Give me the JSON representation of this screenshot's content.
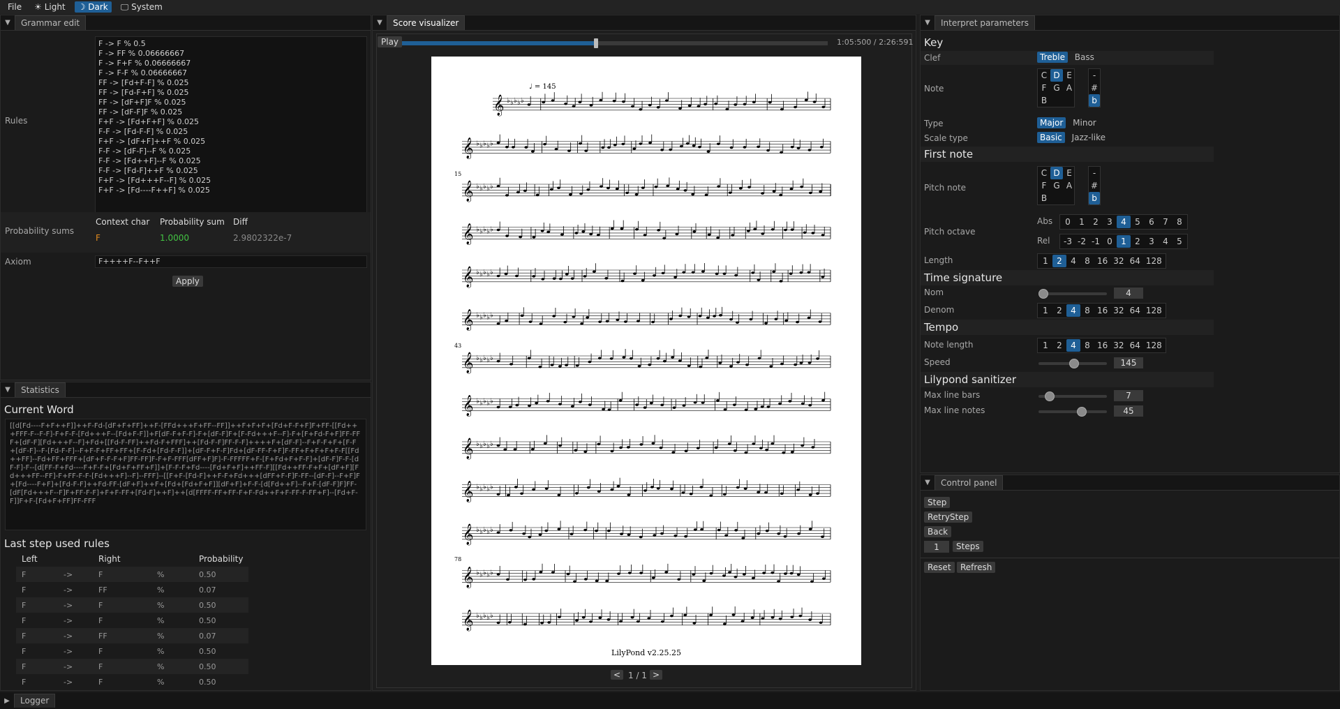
{
  "menubar": {
    "file": "File",
    "light": "Light",
    "dark": "Dark",
    "system": "System"
  },
  "grammar": {
    "tab": "Grammar edit",
    "rules_label": "Rules",
    "rules": [
      "F -> F % 0.5",
      "F -> FF % 0.06666667",
      "F -> F+F % 0.06666667",
      "F -> F-F % 0.06666667",
      "FF -> [Fd+F-F] % 0.025",
      "FF -> [Fd-F+F] % 0.025",
      "FF -> [dF+F]F % 0.025",
      "FF -> [dF-F]F % 0.025",
      "F+F -> [Fd+F+F] % 0.025",
      "F-F -> [Fd-F-F] % 0.025",
      "F+F -> [dF+F]++F % 0.025",
      "F-F -> [dF-F]--F % 0.025",
      "F-F -> [Fd++F]--F % 0.025",
      "F-F -> [Fd-F]++F % 0.025",
      "F+F -> [Fd+++F--F] % 0.025",
      "F+F -> [Fd----F++F] % 0.025"
    ],
    "prob_label": "Probability sums",
    "prob_headers": [
      "Context char",
      "Probability sum",
      "Diff"
    ],
    "prob_row": [
      "F",
      "1.0000",
      "2.9802322e-7"
    ],
    "axiom_label": "Axiom",
    "axiom": "F++++F--F++F",
    "apply": "Apply"
  },
  "statistics": {
    "tab": "Statistics",
    "current_word_title": "Current Word",
    "current_word": "[[d[Fd----F+F++F]]++F-Fd-[dF+F+FF]++F-[FFd+++F+FF--FF]]++F+F+F+[Fd+F-F+F]F+FF-[[Fd+++FFF-F--F-F]-F+F-F-[Fd+++F--[Fd+F-F]]+F[dF-F+F-F]-F+[dF-F]F+[F-Fd+++F--F]-F+[F+Fd-F+F]FF-FFF+[dF-F][Fd+++F--F]+Fd+[[Fd-F-FF]++Fd-F+FFF]++[Fd-F-F]FF-F-F]++++F+[dF-F]--F+F-F+F+[F-F+[dF-F]--F-[Fd-F-F]--F+F-F+FF+FF+[F-Fd+[Fd-F-F]]+[dF-F+F-F]Fd+[dF-FF-F+F]F-FF+F+F+F+F-F[[Fd++FF]--Fd+FF+FFF+[dF+F-F-F+F]FF-FF]F-F+F-FFF[dFF+F]F]-F-FFFFF+F-[F+Fd+F+F-F]+[dF-F]F-F-[dF-F]-F--[d[FF-F+Fd----F+F-F+[Fd+F+FF+F]]+[F-F-F+Fd----[Fd+F+F]++FF-F][[Fd++FF-F+F+[dF+F][Fd+++FF--FF]-F+FF-F-F-[Fd+++F]--F]--FFF]--[[F+F-[Fd-F]++F-F+Fd+++[dFF+F-F]F-FF--[dF-F]--F+F]F+[Fd----F+F]+[Fd-F-F]++Fd-FF-[dF+F]++F+[Fd+[Fd+F+F]][dF+F]+F-F-[d[Fd++F]--F+F-[dF-F]F]FF-[dF[Fd+++F--F]F+FF-F-F]+F+F-FF+[Fd-F]++F]++[d[FFFF-FF+FF-F+F-Fd++F+F-FF-F-FF+F]--[Fd+F-F]]F+F-[Fd+F+FF]FF-FFF",
    "last_rules_title": "Last step used rules",
    "headers": [
      "Left",
      "Right",
      "Probability"
    ],
    "rows": [
      [
        "F",
        "->",
        "F",
        "%",
        "0.50"
      ],
      [
        "F",
        "->",
        "FF",
        "%",
        "0.07"
      ],
      [
        "F",
        "->",
        "F",
        "%",
        "0.50"
      ],
      [
        "F",
        "->",
        "F",
        "%",
        "0.50"
      ],
      [
        "F",
        "->",
        "FF",
        "%",
        "0.07"
      ],
      [
        "F",
        "->",
        "F",
        "%",
        "0.50"
      ],
      [
        "F",
        "->",
        "F",
        "%",
        "0.50"
      ],
      [
        "F",
        "->",
        "F",
        "%",
        "0.50"
      ]
    ]
  },
  "score": {
    "tab": "Score visualizer",
    "play": "Play",
    "progress": 0.456,
    "time": "1:05:500 / 2:26:591",
    "tempo_mark": "= 145",
    "measure_numbers": [
      "15",
      "43",
      "78"
    ],
    "footer": "LilyPond v2.25.25",
    "page": "1 / 1",
    "prev": "<",
    "next": ">"
  },
  "params": {
    "tab": "Interpret parameters",
    "key_title": "Key",
    "clef_label": "Clef",
    "clef_options": [
      "Treble",
      "Bass"
    ],
    "note_label": "Note",
    "notes": [
      "C",
      "D",
      "E",
      "F",
      "G",
      "A",
      "B"
    ],
    "accidentals": [
      "-",
      "#",
      "b"
    ],
    "type_label": "Type",
    "type_options": [
      "Major",
      "Minor"
    ],
    "scale_label": "Scale type",
    "scale_options": [
      "Basic",
      "Jazz-like"
    ],
    "first_note_title": "First note",
    "pitch_note_label": "Pitch note",
    "pitch_octave_label": "Pitch octave",
    "abs_label": "Abs",
    "abs_values": [
      "0",
      "1",
      "2",
      "3",
      "4",
      "5",
      "6",
      "7",
      "8"
    ],
    "rel_label": "Rel",
    "rel_values": [
      "-3",
      "-2",
      "-1",
      "0",
      "1",
      "2",
      "3",
      "4",
      "5"
    ],
    "length_label": "Length",
    "lengths": [
      "1",
      "2",
      "4",
      "8",
      "16",
      "32",
      "64",
      "128"
    ],
    "time_sig_title": "Time signature",
    "nom_label": "Nom",
    "nom_value": "4",
    "denom_label": "Denom",
    "tempo_title": "Tempo",
    "note_length_label": "Note length",
    "speed_label": "Speed",
    "speed_value": "145",
    "sanitizer_title": "Lilypond sanitizer",
    "max_bars_label": "Max line bars",
    "max_bars_value": "7",
    "max_notes_label": "Max line notes",
    "max_notes_value": "45"
  },
  "control": {
    "tab": "Control panel",
    "step": "Step",
    "retry": "RetryStep",
    "back": "Back",
    "steps_value": "1",
    "steps": "Steps",
    "reset": "Reset",
    "refresh": "Refresh"
  },
  "logger": {
    "tab": "Logger"
  },
  "colors": {
    "accent": "#1f5f96",
    "orange": "#e08a1e",
    "green": "#43c443"
  }
}
